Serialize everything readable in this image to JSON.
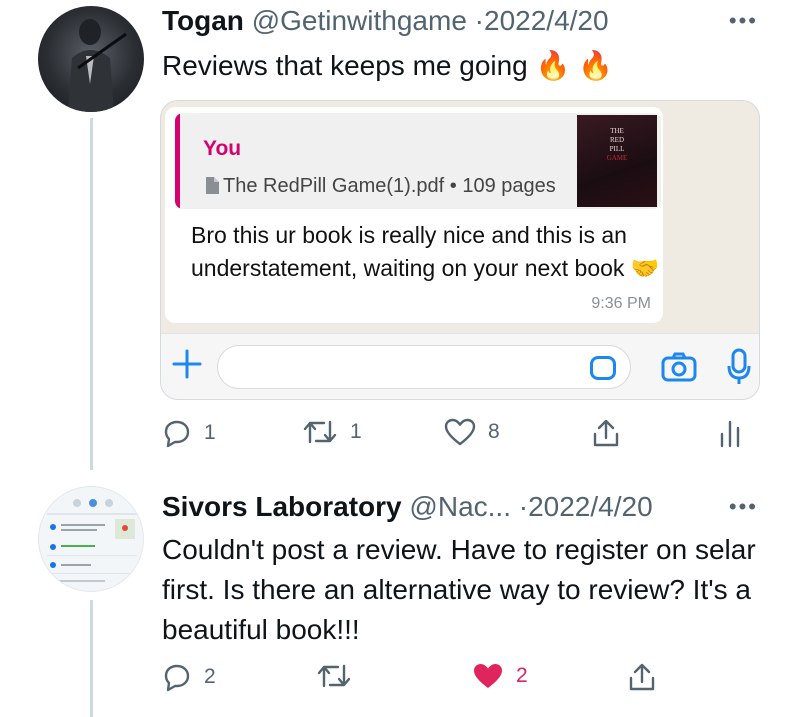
{
  "tweet1": {
    "name": "Togan",
    "handle": "@Getinwithgame",
    "separator": "·",
    "date": "2022/4/20",
    "text": "Reviews that keeps me going 🔥 🔥",
    "more": "•••",
    "embed": {
      "quote_sender": "You",
      "quote_file": "The RedPill Game(1).pdf • 109 pages",
      "thumb_lines": [
        "THE",
        "RED",
        "PILL",
        "GAME"
      ],
      "message": "Bro this ur book is really nice and this is an understatement, waiting on your next book 🤝",
      "time": "9:36 PM"
    },
    "actions": {
      "replies": "1",
      "retweets": "1",
      "likes": "8"
    }
  },
  "tweet2": {
    "name": "Sivors Laboratory",
    "handle": "@Nac...",
    "separator": "·",
    "date": "2022/4/20",
    "text": "Couldn't post a review. Have to register on selar first. Is there an alternative way to review? It's a beautiful book!!!",
    "more": "•••",
    "actions": {
      "replies": "2",
      "retweets": "",
      "likes": "2"
    }
  },
  "colors": {
    "muted": "#536471",
    "like_active": "#e0245e",
    "whatsapp_blue": "#1d87f0",
    "quote_accent": "#d6006f",
    "thread_line": "#cfd9de"
  },
  "icons": [
    "reply-icon",
    "retweet-icon",
    "like-icon",
    "share-icon",
    "analytics-icon",
    "plus-icon",
    "sticker-icon",
    "camera-icon",
    "mic-icon",
    "document-icon"
  ]
}
